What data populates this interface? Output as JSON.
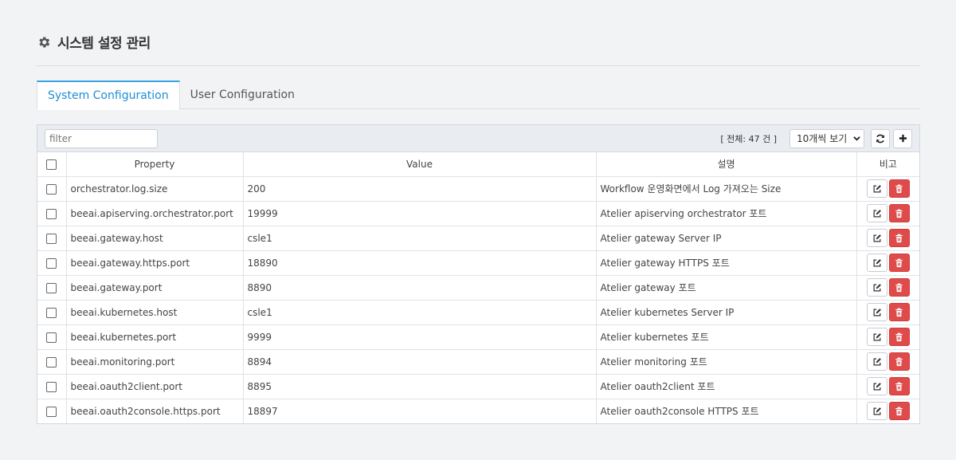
{
  "header": {
    "title": "시스템 설정 관리",
    "icon": "gear-icon"
  },
  "tabs": [
    {
      "label": "System Configuration",
      "active": true
    },
    {
      "label": "User Configuration",
      "active": false
    }
  ],
  "toolbar": {
    "filter_placeholder": "filter",
    "total_text": "[ 전체: 47 건 ]",
    "page_size": "10개씩 보기",
    "refresh_icon": "refresh-icon",
    "add_icon": "plus-icon"
  },
  "table": {
    "headers": [
      "Property",
      "Value",
      "설명",
      "비고"
    ],
    "rows": [
      {
        "property": "orchestrator.log.size",
        "value": "200",
        "desc": "Workflow 운영화면에서 Log 가져오는 Size"
      },
      {
        "property": "beeai.apiserving.orchestrator.port",
        "value": "19999",
        "desc": "Atelier apiserving orchestrator 포트"
      },
      {
        "property": "beeai.gateway.host",
        "value": "csle1",
        "desc": "Atelier gateway Server IP"
      },
      {
        "property": "beeai.gateway.https.port",
        "value": "18890",
        "desc": "Atelier gateway HTTPS 포트"
      },
      {
        "property": "beeai.gateway.port",
        "value": "8890",
        "desc": "Atelier gateway 포트"
      },
      {
        "property": "beeai.kubernetes.host",
        "value": "csle1",
        "desc": "Atelier kubernetes Server IP"
      },
      {
        "property": "beeai.kubernetes.port",
        "value": "9999",
        "desc": "Atelier kubernetes 포트"
      },
      {
        "property": "beeai.monitoring.port",
        "value": "8894",
        "desc": "Atelier monitoring 포트"
      },
      {
        "property": "beeai.oauth2client.port",
        "value": "8895",
        "desc": "Atelier oauth2client 포트"
      },
      {
        "property": "beeai.oauth2console.https.port",
        "value": "18897",
        "desc": "Atelier oauth2console HTTPS 포트"
      }
    ]
  },
  "colors": {
    "accent": "#1d8fd6",
    "danger": "#df4a4a"
  }
}
